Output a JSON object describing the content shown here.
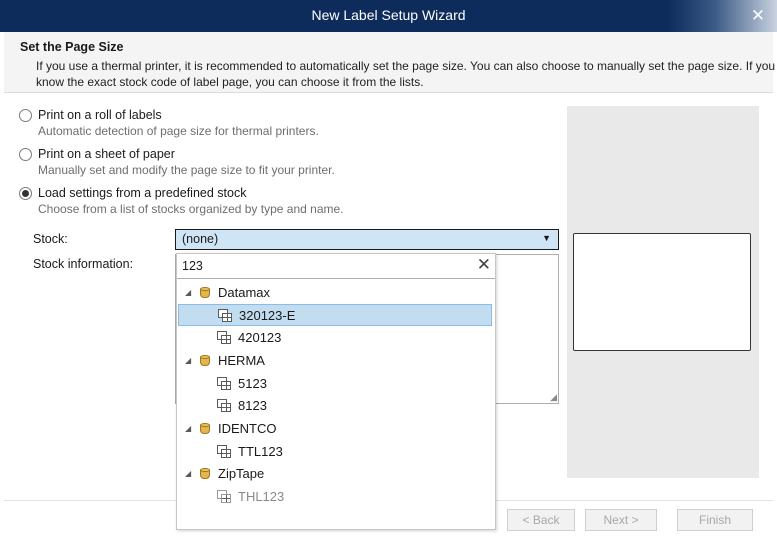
{
  "window": {
    "title": "New Label Setup Wizard",
    "close_glyph": "✕"
  },
  "header": {
    "title": "Set the Page Size",
    "description": "If you use a thermal printer, it is recommended to automatically set the page size. You can also choose to manually set the page size. If you know the exact stock code of label page, you can choose it from the lists."
  },
  "options": [
    {
      "label": "Print on a roll of labels",
      "description": "Automatic detection of page size for thermal printers.",
      "checked": false
    },
    {
      "label": "Print on a sheet of paper",
      "description": "Manually set and modify the page size to fit your printer.",
      "checked": false
    },
    {
      "label": "Load settings from a predefined stock",
      "description": "Choose from a list of stocks organized by type and name.",
      "checked": true
    }
  ],
  "stock": {
    "label": "Stock:",
    "value": "(none)"
  },
  "stock_info": {
    "label": "Stock information:"
  },
  "dropdown": {
    "search_text": "123",
    "clear_glyph": "✕",
    "groups": [
      {
        "name": "Datamax",
        "items": [
          "320123-E",
          "420123"
        ]
      },
      {
        "name": "HERMA",
        "items": [
          "5123",
          "8123"
        ]
      },
      {
        "name": "IDENTCO",
        "items": [
          "TTL123"
        ]
      },
      {
        "name": "ZipTape",
        "items": [
          "THL123"
        ]
      }
    ],
    "selected_item": "320123-E"
  },
  "footer": {
    "back_label": "< Back",
    "next_label": "Next >",
    "finish_label": "Finish"
  },
  "colors": {
    "titlebar": "#0d2c5c",
    "selection": "#c3ddf0",
    "stock_select_bg": "#cfe4f5"
  }
}
